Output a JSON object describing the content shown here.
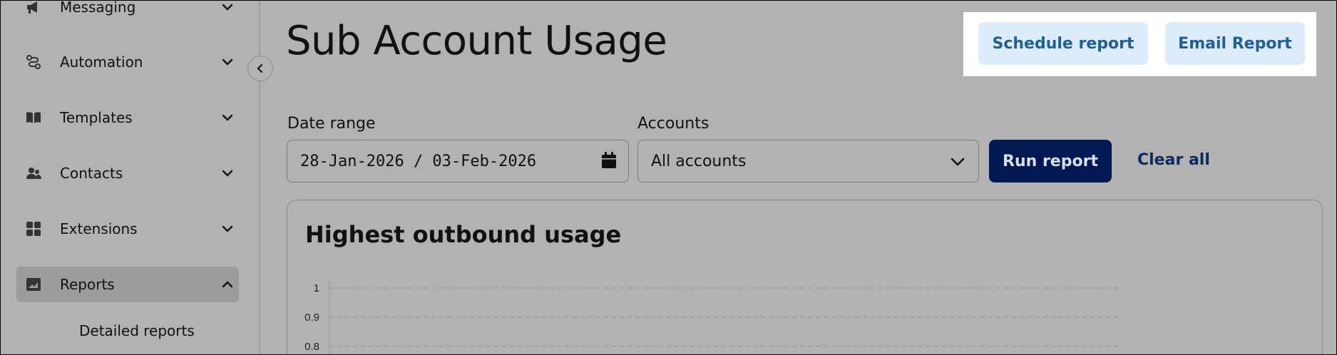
{
  "sidebar": {
    "items": [
      {
        "label": "Messaging",
        "icon": "megaphone-icon",
        "expanded": false
      },
      {
        "label": "Automation",
        "icon": "route-icon",
        "expanded": false
      },
      {
        "label": "Templates",
        "icon": "open-book-icon",
        "expanded": false
      },
      {
        "label": "Contacts",
        "icon": "users-icon",
        "expanded": false
      },
      {
        "label": "Extensions",
        "icon": "grid-icon",
        "expanded": false
      },
      {
        "label": "Reports",
        "icon": "chart-image-icon",
        "expanded": true
      }
    ],
    "sub_items": [
      {
        "label": "Detailed reports"
      }
    ]
  },
  "header": {
    "title": "Sub Account Usage",
    "schedule_label": "Schedule report",
    "email_label": "Email Report"
  },
  "filters": {
    "date_label": "Date range",
    "date_value": "28-Jan-2026 / 03-Feb-2026",
    "accounts_label": "Accounts",
    "accounts_value": "All accounts",
    "run_label": "Run report",
    "clear_label": "Clear all"
  },
  "colors": {
    "run_button": "#021853",
    "light_button_bg": "#dcecfa",
    "light_button_text": "#1f5f9a",
    "clear_link": "#0d2a5c",
    "highlight": "#ffffff"
  },
  "chart_data": {
    "type": "bar",
    "title": "Highest outbound usage",
    "xlabel": "",
    "ylabel": "",
    "ylim": [
      0,
      1
    ],
    "yticks": [
      1,
      0.9,
      0.8
    ],
    "grid": true,
    "categories": [],
    "values": []
  }
}
